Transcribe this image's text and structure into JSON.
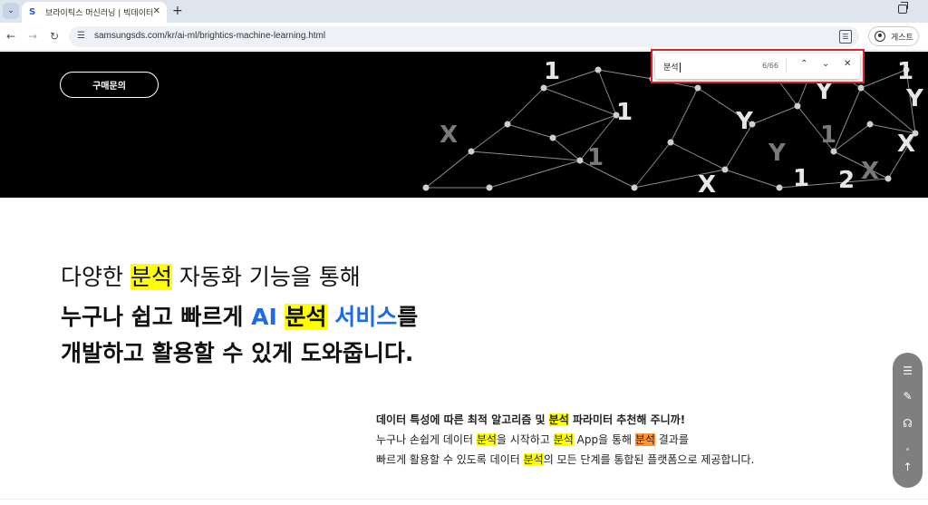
{
  "browser": {
    "tab_title": "브라이틱스 머신러닝 | 빅데이터",
    "favicon_letter": "S",
    "url": "samsungsds.com/kr/ai-ml/brightics-machine-learning.html",
    "guest_label": "게스트"
  },
  "find": {
    "query": "분석",
    "count": "6/66"
  },
  "hero": {
    "buy_button": "구매문의",
    "bg_glyphs": [
      "X",
      "1",
      "Y",
      "1",
      "X",
      "1",
      "Y",
      "1",
      "Y",
      "1",
      "2",
      "X",
      "X",
      "Y",
      "1"
    ]
  },
  "headline": {
    "line1_pre": "다양한 ",
    "line1_hl": "분석",
    "line1_post": " 자동화 기능을 통해",
    "line2_pre": "누구나 쉽고 빠르게 ",
    "line2_ai": "AI ",
    "line2_hl": "분석",
    "line2_svc": " 서비스",
    "line2_post": "를",
    "line3": "개발하고 활용할 수 있게 도와줍니다."
  },
  "description": {
    "l1_pre": "데이터 특성에 따른 최적 알고리즘 및 ",
    "l1_hl": "분석",
    "l1_post": " 파라미터 추천해 주니까!",
    "l2_a": "누구나 손쉽게 데이터 ",
    "l2_hl1": "분석",
    "l2_b": "을 시작하고 ",
    "l2_hl2": "분석",
    "l2_c": " App을 통해 ",
    "l2_hl3": "분석",
    "l2_d": " 결과를",
    "l3_a": "빠르게 활용할 수 있도록 데이터 ",
    "l3_hl": "분석",
    "l3_b": "의 모든 단계를 통합된 플랫폼으로 제공합니다."
  },
  "colors": {
    "highlight": "#ffff00",
    "current_match": "#ff9632",
    "accent_blue": "#1d6bea",
    "find_outline": "#d7262c"
  }
}
